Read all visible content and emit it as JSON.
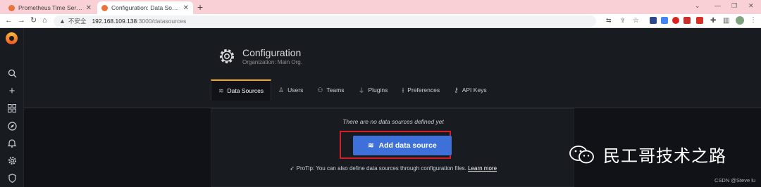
{
  "browser": {
    "tabs": [
      {
        "title": "Prometheus Time Series Colle",
        "active": false
      },
      {
        "title": "Configuration: Data Sources - ",
        "active": true
      }
    ],
    "new_tab": "+",
    "address": {
      "security_label": "不安全",
      "host": "192.168.109.138",
      "path": ":3000/datasources"
    }
  },
  "page": {
    "title": "Configuration",
    "subtitle": "Organization: Main Org.",
    "tabs": [
      {
        "label": "Data Sources",
        "icon": "database-icon",
        "active": true
      },
      {
        "label": "Users",
        "icon": "user-icon",
        "active": false
      },
      {
        "label": "Teams",
        "icon": "users-icon",
        "active": false
      },
      {
        "label": "Plugins",
        "icon": "plug-icon",
        "active": false
      },
      {
        "label": "Preferences",
        "icon": "sliders-icon",
        "active": false
      },
      {
        "label": "API Keys",
        "icon": "key-icon",
        "active": false
      }
    ],
    "empty": {
      "message": "There are no data sources defined yet",
      "button_label": "Add data source",
      "protip_text": "ProTip: You can also define data sources through configuration files.",
      "protip_link": "Learn more"
    }
  },
  "sidenav": {
    "icons": [
      "grafana-logo",
      "search-icon",
      "plus-icon",
      "dashboards-icon",
      "explore-icon",
      "alerting-icon",
      "configuration-icon",
      "shield-icon"
    ]
  },
  "overlay": {
    "watermark": "民工哥技术之路",
    "credit": "CSDN @Steve lu"
  },
  "colors": {
    "accent_tab": "#f5a623",
    "primary_button": "#3d71d9",
    "highlight_box": "#d41f2b",
    "background": "#111217"
  }
}
